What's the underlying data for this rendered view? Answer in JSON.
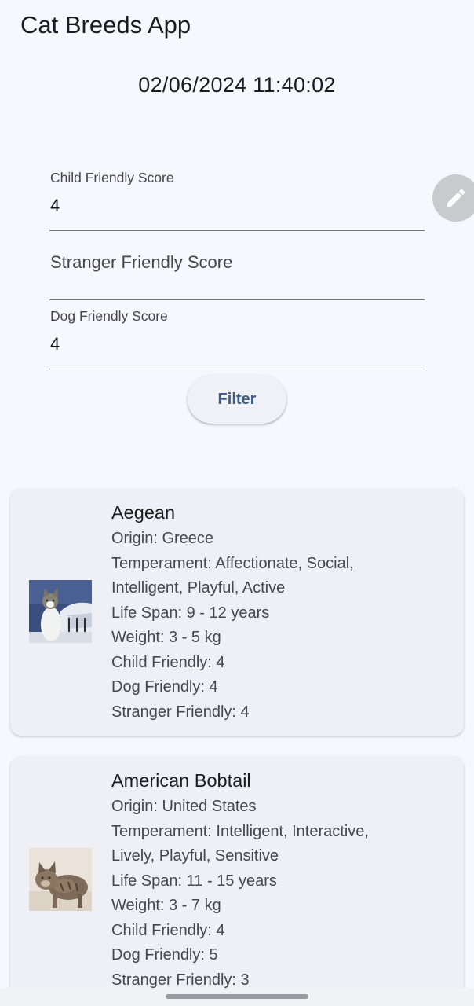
{
  "app": {
    "title": "Cat Breeds App",
    "datetime": "02/06/2024 11:40:02"
  },
  "filters": {
    "child_friendly": {
      "label": "Child Friendly Score",
      "value": "4"
    },
    "stranger_friendly": {
      "label": "Stranger Friendly Score",
      "value": ""
    },
    "dog_friendly": {
      "label": "Dog Friendly Score",
      "value": "4"
    },
    "filter_button": "Filter"
  },
  "edit_fab_icon": "pencil-icon",
  "breeds": [
    {
      "name": "Aegean",
      "origin": "Origin: Greece",
      "temperament_1": "Temperament: Affectionate, Social,",
      "temperament_2": "Intelligent, Playful, Active",
      "life_span": "Life Span: 9 - 12 years",
      "weight": "Weight: 3 - 5 kg",
      "child_friendly": "Child Friendly: 4",
      "dog_friendly": "Dog Friendly: 4",
      "stranger_friendly": "Stranger Friendly: 4"
    },
    {
      "name": "American Bobtail",
      "origin": "Origin: United States",
      "temperament_1": "Temperament: Intelligent, Interactive,",
      "temperament_2": "Lively, Playful, Sensitive",
      "life_span": "Life Span: 11 - 15 years",
      "weight": "Weight: 3 - 7 kg",
      "child_friendly": "Child Friendly: 4",
      "dog_friendly": "Dog Friendly: 5",
      "stranger_friendly": "Stranger Friendly: 3"
    }
  ],
  "colors": {
    "background": "#f7f8fd",
    "card": "#eff0f6",
    "accent": "#3f5f86",
    "fab": "#c9cacd"
  }
}
